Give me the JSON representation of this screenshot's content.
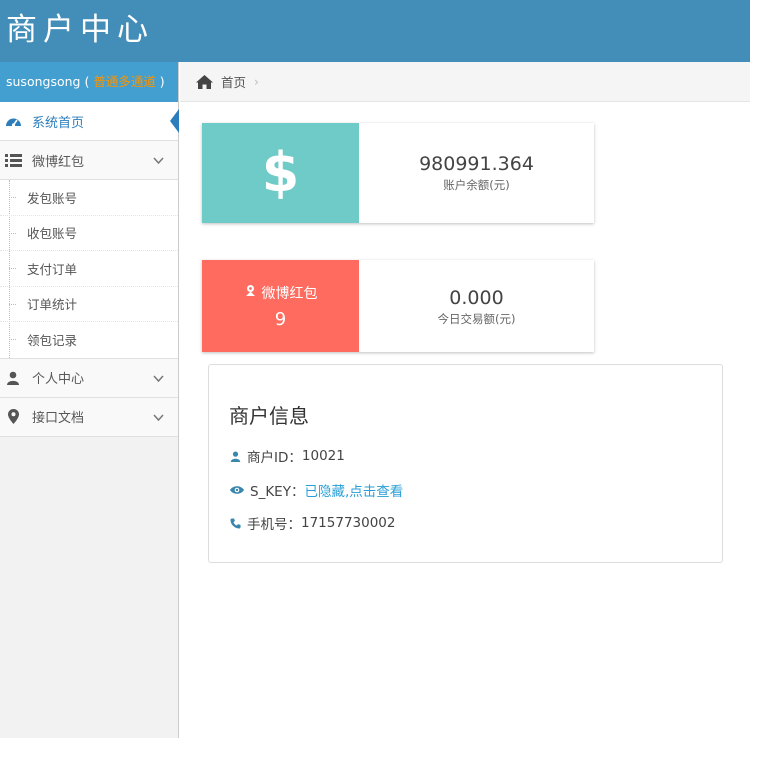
{
  "header": {
    "title": "商户中心"
  },
  "user": {
    "name": "susongsong",
    "open_paren": " ( ",
    "level": "普通多通道",
    "close_paren": " )"
  },
  "sidebar": {
    "items": [
      {
        "label": "系统首页",
        "icon": "dashboard-icon"
      },
      {
        "label": "微博红包",
        "icon": "list-icon",
        "submenu": [
          "发包账号",
          "收包账号",
          "支付订单",
          "订单统计",
          "领包记录"
        ]
      },
      {
        "label": "个人中心",
        "icon": "user-icon"
      },
      {
        "label": "接口文档",
        "icon": "map-marker-icon"
      }
    ]
  },
  "breadcrumb": {
    "home": "首页",
    "separator": "›"
  },
  "stats": {
    "balance": {
      "symbol": "$",
      "value": "980991.364",
      "label": "账户余额(元)"
    },
    "redpack": {
      "title": "微博红包",
      "count": "9",
      "value": "0.000",
      "label": "今日交易额(元)"
    }
  },
  "info": {
    "title": "商户信息",
    "merchant_id_label": "商户ID：",
    "merchant_id": "10021",
    "skey_label": "S_KEY：",
    "skey_link": "已隐藏,点击查看",
    "phone_label": "手机号：",
    "phone": "17157730002"
  },
  "colors": {
    "header": "#438eb9",
    "user_bar": "#429fcf",
    "teal": "#6fcbc7",
    "coral": "#ff6b5f",
    "link": "#2a9fd6",
    "accent_level": "#f89406"
  }
}
